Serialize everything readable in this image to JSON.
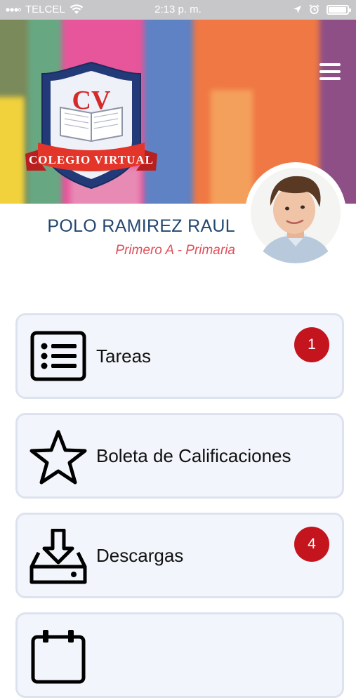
{
  "status_bar": {
    "carrier": "TELCEL",
    "time": "2:13 p. m.",
    "battery_level": 0.92
  },
  "header": {
    "logo": {
      "initials": "CV",
      "text": "Colegio Virtual"
    },
    "menu_icon": "hamburger-icon"
  },
  "profile": {
    "name": "POLO RAMIREZ RAUL",
    "grade": "Primero A - Primaria"
  },
  "menu": [
    {
      "label": "Tareas",
      "icon": "task-list-icon",
      "badge": "1"
    },
    {
      "label": "Boleta de Calificaciones",
      "icon": "star-icon",
      "badge": null
    },
    {
      "label": "Descargas",
      "icon": "download-icon",
      "badge": "4"
    },
    {
      "label": "",
      "icon": "calendar-icon",
      "badge": null
    }
  ],
  "colors": {
    "name": "#23476f",
    "grade": "#e0505a",
    "badge": "#c4141d",
    "card_bg": "#f2f5fb",
    "card_border": "#dde3ee"
  }
}
